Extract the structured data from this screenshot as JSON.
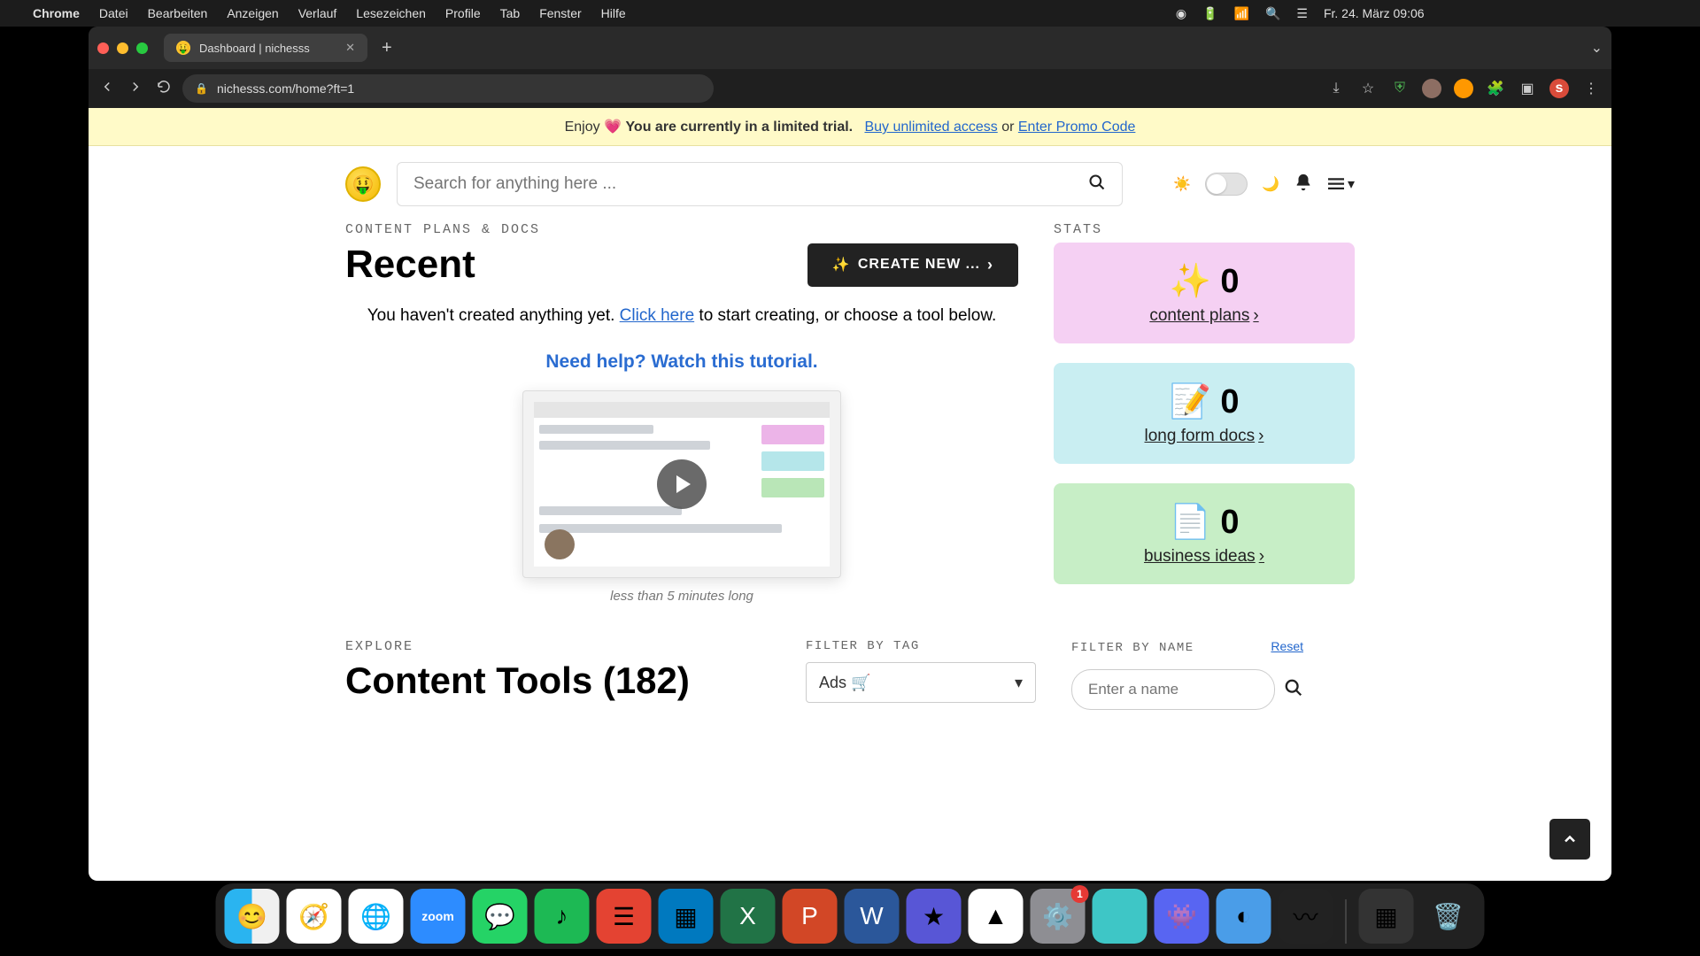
{
  "menubar": {
    "apple": "",
    "app": "Chrome",
    "items": [
      "Datei",
      "Bearbeiten",
      "Anzeigen",
      "Verlauf",
      "Lesezeichen",
      "Profile",
      "Tab",
      "Fenster",
      "Hilfe"
    ],
    "clock": "Fr. 24. März  09:06"
  },
  "browser": {
    "tab_title": "Dashboard | nichesss",
    "url": "nichesss.com/home?ft=1",
    "profile_letter": "s"
  },
  "banner": {
    "prefix": "Enjoy 💗 ",
    "bold": "You are currently in a limited trial.",
    "link1": "Buy unlimited access",
    "or": " or ",
    "link2": "Enter Promo Code"
  },
  "header": {
    "search_placeholder": "Search for anything here ..."
  },
  "content": {
    "eyebrow": "CONTENT PLANS & DOCS",
    "title": "Recent",
    "cta": "CREATE NEW ...",
    "empty_prefix": "You haven't created anything yet. ",
    "empty_link": "Click here",
    "empty_suffix": " to start creating, or choose a tool below.",
    "tutorial_link": "Need help? Watch this tutorial.",
    "tutorial_caption": "less than 5 minutes long"
  },
  "stats": {
    "eyebrow": "STATS",
    "cards": [
      {
        "emoji": "✨",
        "value": "0",
        "label": "content plans"
      },
      {
        "emoji": "📝",
        "value": "0",
        "label": "long form docs"
      },
      {
        "emoji": "📄",
        "value": "0",
        "label": "business ideas"
      }
    ]
  },
  "explore": {
    "eyebrow": "EXPLORE",
    "title": "Content Tools (182)",
    "filter_tag_label": "FILTER BY TAG",
    "filter_tag_value": "Ads 🛒",
    "filter_name_label": "FILTER BY NAME",
    "filter_name_placeholder": "Enter a name",
    "reset": "Reset"
  },
  "dock": {
    "apps": [
      "finder",
      "safari",
      "chrome",
      "zoom",
      "whatsapp",
      "spotify",
      "todoist",
      "trello",
      "excel",
      "powerpoint",
      "word",
      "imovie",
      "drive",
      "settings",
      "app1",
      "discord",
      "app2",
      "app3"
    ],
    "badge_index": 13,
    "badge_value": "1"
  }
}
